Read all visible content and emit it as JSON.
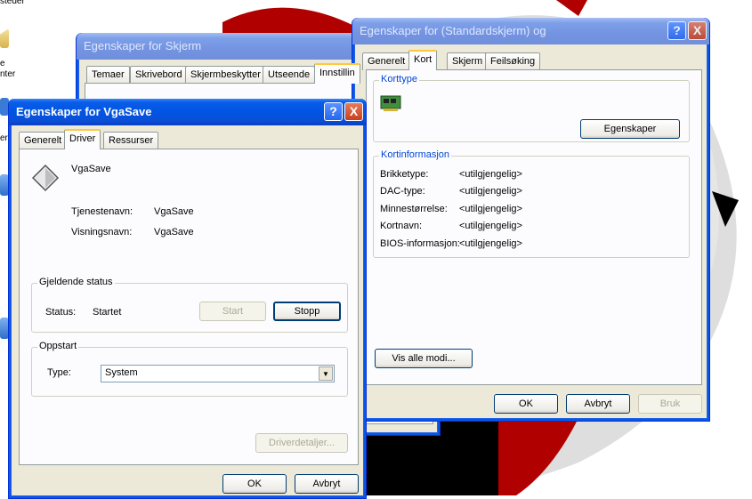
{
  "desktop": {
    "icon_labels": [
      "steder",
      "e",
      "nter",
      "er"
    ]
  },
  "skjerm_window": {
    "title": "Egenskaper for Skjerm",
    "tabs": [
      "Temaer",
      "Skrivebord",
      "Skjermbeskytter",
      "Utseende",
      "Innstillin"
    ]
  },
  "vgasave_window": {
    "title": "Egenskaper for VgaSave",
    "help_btn": "?",
    "close_btn": "X",
    "tabs": [
      "Generelt",
      "Driver",
      "Ressurser"
    ],
    "device_name": "VgaSave",
    "service_label": "Tjenestenavn:",
    "service_value": "VgaSave",
    "display_label": "Visningsnavn:",
    "display_value": "VgaSave",
    "status_group": "Gjeldende status",
    "status_label": "Status:",
    "status_value": "Startet",
    "start_btn": "Start",
    "stop_btn": "Stopp",
    "startup_group": "Oppstart",
    "type_label": "Type:",
    "type_value": "System",
    "driver_details_btn": "Driverdetaljer...",
    "ok_btn": "OK",
    "cancel_btn": "Avbryt"
  },
  "standard_window": {
    "title": "Egenskaper for (Standardskjerm) og",
    "help_btn": "?",
    "close_btn": "X",
    "tabs": [
      "Generelt",
      "Kort",
      "Skjerm",
      "Feilsøking"
    ],
    "adapter_type_group": "Korttype",
    "properties_btn": "Egenskaper",
    "adapter_info_group": "Kortinformasjon",
    "info": [
      {
        "label": "Brikketype:",
        "value": "<utilgjengelig>"
      },
      {
        "label": "DAC-type:",
        "value": "<utilgjengelig>"
      },
      {
        "label": "Minnestørrelse:",
        "value": "<utilgjengelig>"
      },
      {
        "label": "Kortnavn:",
        "value": "<utilgjengelig>"
      },
      {
        "label": "BIOS-informasjon:",
        "value": "<utilgjengelig>"
      }
    ],
    "list_modes_btn": "Vis alle modi...",
    "ok_btn": "OK",
    "cancel_btn": "Avbryt",
    "apply_btn": "Bruk"
  },
  "colors": {
    "xp_blue": "#0055e5",
    "dialog_bg": "#ece9d8",
    "group_label": "#0046d5",
    "wallpaper_red": "#c00000"
  }
}
